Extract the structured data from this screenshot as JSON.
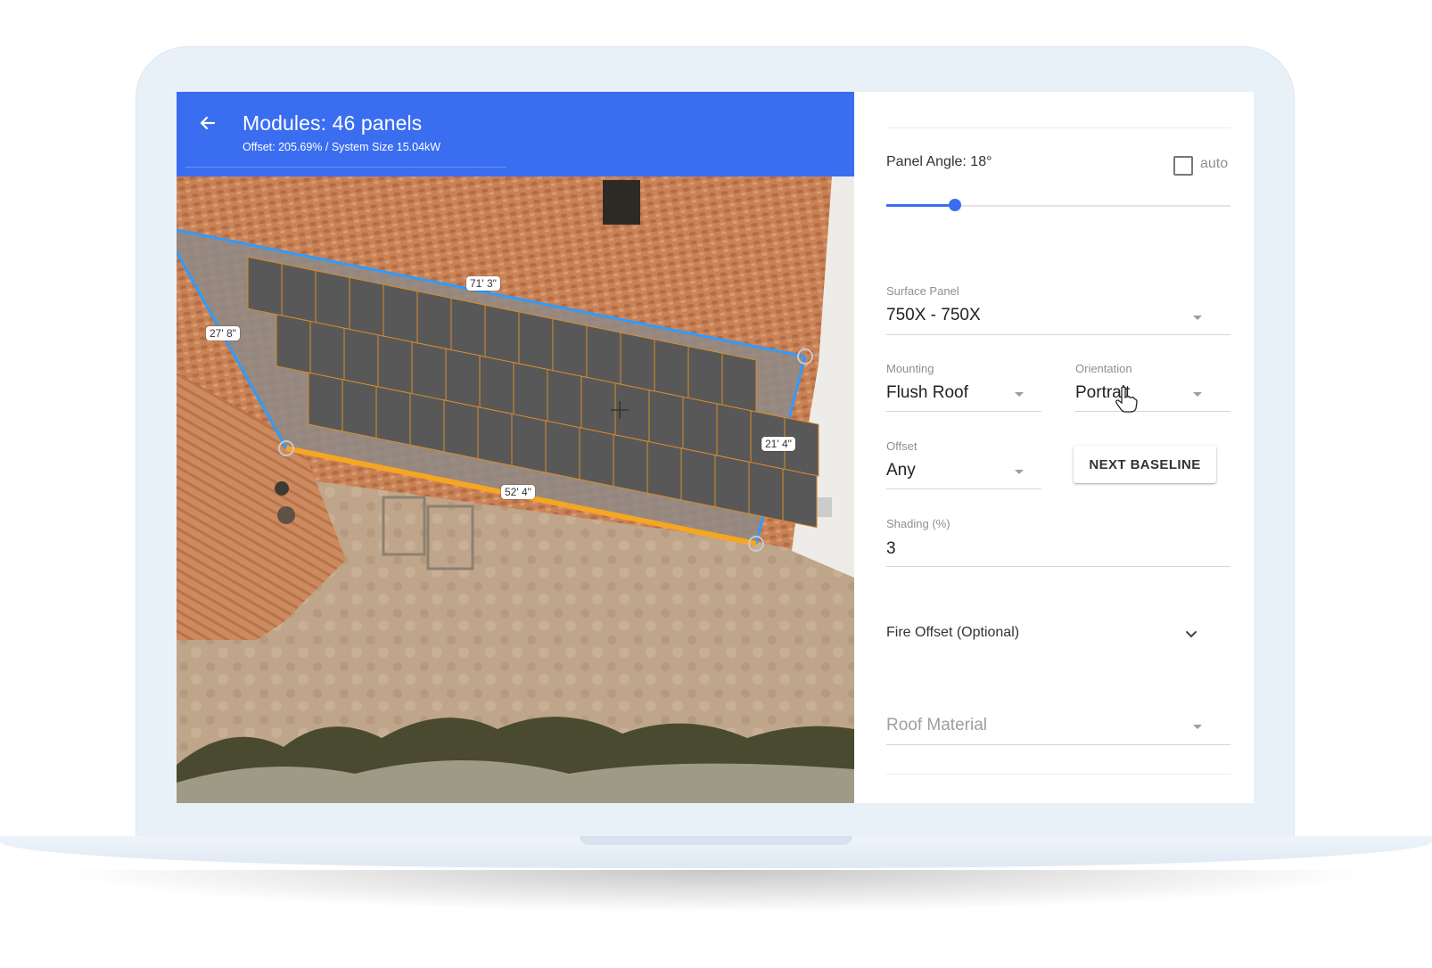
{
  "header": {
    "back_icon": "arrow-left-icon",
    "title": "Modules: 46 panels",
    "subtitle": "Offset: 205.69% / System Size 15.04kW"
  },
  "map": {
    "dimensions": {
      "top_edge": "71' 3\"",
      "left_edge": "27' 8\"",
      "right_edge": "21' 4\"",
      "bottom_edge": "52' 4\""
    },
    "center_icon": "crosshair-icon",
    "colors": {
      "outline": "#2f9bff",
      "baseline": "#f5a623",
      "panel": "#585858"
    }
  },
  "settings": {
    "panel_angle": {
      "label": "Panel Angle: 18°",
      "auto_label": "auto",
      "auto_checked": false,
      "slider_fraction": 0.2
    },
    "surface_panel": {
      "label": "Surface Panel",
      "value": "750X - 750X"
    },
    "mounting": {
      "label": "Mounting",
      "value": "Flush Roof"
    },
    "orientation": {
      "label": "Orientation",
      "value": "Portrait"
    },
    "offset": {
      "label": "Offset",
      "value": "Any"
    },
    "next_baseline": "NEXT BASELINE",
    "shading": {
      "label": "Shading (%)",
      "value": "3"
    },
    "fire_offset": {
      "label": "Fire Offset (Optional)",
      "icon": "chevron-down-icon"
    },
    "roof_material": {
      "placeholder": "Roof Material"
    }
  },
  "accent_color": "#3a6df0"
}
